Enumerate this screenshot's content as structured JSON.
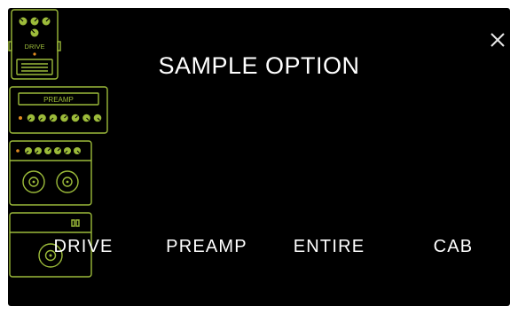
{
  "dialog": {
    "title": "SAMPLE OPTION",
    "close_icon": "close-icon"
  },
  "accent_color": "#9CBB3A",
  "options": [
    {
      "label": "DRIVE",
      "icon": "drive-pedal-icon",
      "pedal_text": "DRIVE"
    },
    {
      "label": "PREAMP",
      "icon": "preamp-icon",
      "display_text": "PREAMP"
    },
    {
      "label": "ENTIRE",
      "icon": "amp-combo-icon"
    },
    {
      "label": "CAB",
      "icon": "cabinet-icon"
    }
  ]
}
